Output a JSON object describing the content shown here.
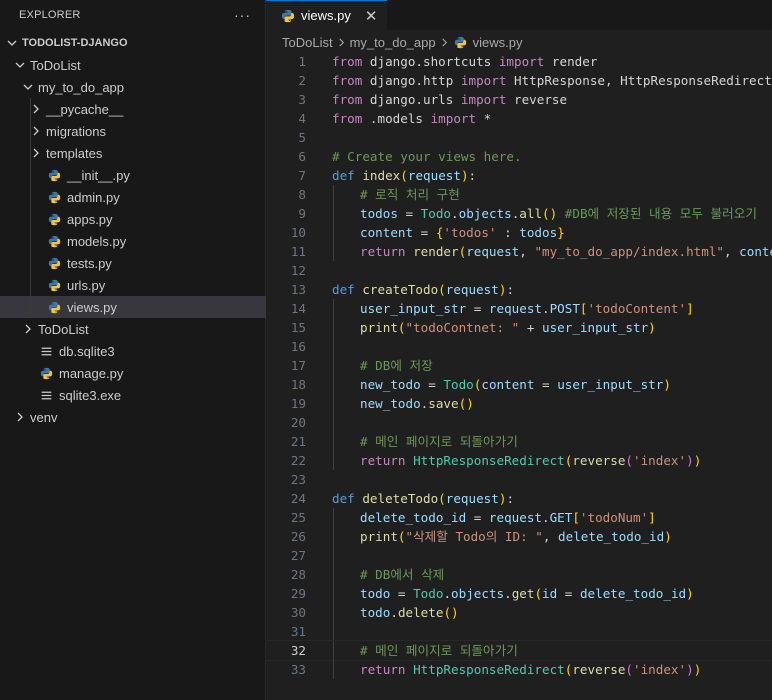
{
  "sidebar": {
    "title": "EXPLORER",
    "more_label": "···",
    "items": [
      {
        "label": "TODOLIST-DJANGO",
        "kind": "root-folder",
        "expanded": true,
        "level": 0
      },
      {
        "label": "ToDoList",
        "kind": "folder",
        "expanded": true,
        "level": 1
      },
      {
        "label": "my_to_do_app",
        "kind": "folder",
        "expanded": true,
        "level": 2
      },
      {
        "label": "__pycache__",
        "kind": "folder",
        "expanded": false,
        "level": 3
      },
      {
        "label": "migrations",
        "kind": "folder",
        "expanded": false,
        "level": 3
      },
      {
        "label": "templates",
        "kind": "folder",
        "expanded": false,
        "level": 3
      },
      {
        "label": "__init__.py",
        "kind": "python-file",
        "level": 3
      },
      {
        "label": "admin.py",
        "kind": "python-file",
        "level": 3
      },
      {
        "label": "apps.py",
        "kind": "python-file",
        "level": 3
      },
      {
        "label": "models.py",
        "kind": "python-file",
        "level": 3
      },
      {
        "label": "tests.py",
        "kind": "python-file",
        "level": 3
      },
      {
        "label": "urls.py",
        "kind": "python-file",
        "level": 3
      },
      {
        "label": "views.py",
        "kind": "python-file",
        "level": 3,
        "selected": true
      },
      {
        "label": "ToDoList",
        "kind": "folder",
        "expanded": false,
        "level": 2
      },
      {
        "label": "db.sqlite3",
        "kind": "db-file",
        "level": 2
      },
      {
        "label": "manage.py",
        "kind": "python-file",
        "level": 2
      },
      {
        "label": "sqlite3.exe",
        "kind": "db-file",
        "level": 2
      },
      {
        "label": "venv",
        "kind": "folder",
        "expanded": false,
        "level": 1
      }
    ]
  },
  "tab": {
    "label": "views.py",
    "close_label": "✕",
    "icon": "python-file-icon"
  },
  "breadcrumb": [
    "ToDoList",
    "my_to_do_app",
    "views.py"
  ],
  "editor": {
    "current_line": 32,
    "lines": [
      {
        "n": "1",
        "tokens": [
          [
            "kw",
            "from"
          ],
          [
            "plain",
            " django.shortcuts "
          ],
          [
            "kw",
            "import"
          ],
          [
            "plain",
            " render"
          ]
        ]
      },
      {
        "n": "2",
        "tokens": [
          [
            "kw",
            "from"
          ],
          [
            "plain",
            " django.http "
          ],
          [
            "kw",
            "import"
          ],
          [
            "plain",
            " HttpResponse, HttpResponseRedirect"
          ]
        ]
      },
      {
        "n": "3",
        "tokens": [
          [
            "kw",
            "from"
          ],
          [
            "plain",
            " django.urls "
          ],
          [
            "kw",
            "import"
          ],
          [
            "plain",
            " reverse"
          ]
        ]
      },
      {
        "n": "4",
        "tokens": [
          [
            "kw",
            "from"
          ],
          [
            "plain",
            " .models "
          ],
          [
            "kw",
            "import"
          ],
          [
            "plain",
            " *"
          ]
        ]
      },
      {
        "n": "5",
        "tokens": []
      },
      {
        "n": "6",
        "tokens": [
          [
            "cm",
            "# Create your views here."
          ]
        ]
      },
      {
        "n": "7",
        "tokens": [
          [
            "kw2",
            "def"
          ],
          [
            "plain",
            " "
          ],
          [
            "fn",
            "index"
          ],
          [
            "brk1",
            "("
          ],
          [
            "var",
            "request"
          ],
          [
            "brk1",
            ")"
          ],
          [
            "plain",
            ":"
          ]
        ]
      },
      {
        "n": "8",
        "indent": 1,
        "tokens": [
          [
            "cm",
            "# 로직 처리 구현"
          ]
        ]
      },
      {
        "n": "9",
        "indent": 1,
        "tokens": [
          [
            "var",
            "todos"
          ],
          [
            "plain",
            " = "
          ],
          [
            "cls",
            "Todo"
          ],
          [
            "plain",
            "."
          ],
          [
            "var",
            "objects"
          ],
          [
            "plain",
            "."
          ],
          [
            "fn",
            "all"
          ],
          [
            "brk1",
            "()"
          ],
          [
            "plain",
            " "
          ],
          [
            "cm",
            "#DB에 저장된 내용 모두 불러오기"
          ]
        ]
      },
      {
        "n": "10",
        "indent": 1,
        "tokens": [
          [
            "var",
            "content"
          ],
          [
            "plain",
            " = "
          ],
          [
            "brk1",
            "{"
          ],
          [
            "str",
            "'todos'"
          ],
          [
            "plain",
            " : "
          ],
          [
            "var",
            "todos"
          ],
          [
            "brk1",
            "}"
          ]
        ]
      },
      {
        "n": "11",
        "indent": 1,
        "tokens": [
          [
            "kw",
            "return"
          ],
          [
            "plain",
            " "
          ],
          [
            "fn",
            "render"
          ],
          [
            "brk1",
            "("
          ],
          [
            "var",
            "request"
          ],
          [
            "plain",
            ", "
          ],
          [
            "str",
            "\"my_to_do_app/index.html\""
          ],
          [
            "plain",
            ", "
          ],
          [
            "var",
            "content"
          ],
          [
            "brk1",
            ")"
          ]
        ]
      },
      {
        "n": "12",
        "tokens": []
      },
      {
        "n": "13",
        "tokens": [
          [
            "kw2",
            "def"
          ],
          [
            "plain",
            " "
          ],
          [
            "fn",
            "createTodo"
          ],
          [
            "brk1",
            "("
          ],
          [
            "var",
            "request"
          ],
          [
            "brk1",
            ")"
          ],
          [
            "plain",
            ":"
          ]
        ]
      },
      {
        "n": "14",
        "indent": 1,
        "tokens": [
          [
            "var",
            "user_input_str"
          ],
          [
            "plain",
            " = "
          ],
          [
            "var",
            "request"
          ],
          [
            "plain",
            "."
          ],
          [
            "var",
            "POST"
          ],
          [
            "brk1",
            "["
          ],
          [
            "str",
            "'todoContent'"
          ],
          [
            "brk1",
            "]"
          ]
        ]
      },
      {
        "n": "15",
        "indent": 1,
        "tokens": [
          [
            "fn",
            "print"
          ],
          [
            "brk1",
            "("
          ],
          [
            "str",
            "\"todoContnet: \""
          ],
          [
            "plain",
            " + "
          ],
          [
            "var",
            "user_input_str"
          ],
          [
            "brk1",
            ")"
          ]
        ]
      },
      {
        "n": "16",
        "indent": 1,
        "tokens": []
      },
      {
        "n": "17",
        "indent": 1,
        "tokens": [
          [
            "cm",
            "# DB에 저장"
          ]
        ]
      },
      {
        "n": "18",
        "indent": 1,
        "tokens": [
          [
            "var",
            "new_todo"
          ],
          [
            "plain",
            " = "
          ],
          [
            "cls",
            "Todo"
          ],
          [
            "brk1",
            "("
          ],
          [
            "var",
            "content"
          ],
          [
            "plain",
            " = "
          ],
          [
            "var",
            "user_input_str"
          ],
          [
            "brk1",
            ")"
          ]
        ]
      },
      {
        "n": "19",
        "indent": 1,
        "tokens": [
          [
            "var",
            "new_todo"
          ],
          [
            "plain",
            "."
          ],
          [
            "fn",
            "save"
          ],
          [
            "brk1",
            "()"
          ]
        ]
      },
      {
        "n": "20",
        "indent": 1,
        "tokens": []
      },
      {
        "n": "21",
        "indent": 1,
        "tokens": [
          [
            "cm",
            "# 메인 페이지로 되돌아가기"
          ]
        ]
      },
      {
        "n": "22",
        "indent": 1,
        "tokens": [
          [
            "kw",
            "return"
          ],
          [
            "plain",
            " "
          ],
          [
            "cls",
            "HttpResponseRedirect"
          ],
          [
            "brk1",
            "("
          ],
          [
            "fn",
            "reverse"
          ],
          [
            "brk2",
            "("
          ],
          [
            "str",
            "'index'"
          ],
          [
            "brk2",
            ")"
          ],
          [
            "brk1",
            ")"
          ]
        ]
      },
      {
        "n": "23",
        "tokens": []
      },
      {
        "n": "24",
        "tokens": [
          [
            "kw2",
            "def"
          ],
          [
            "plain",
            " "
          ],
          [
            "fn",
            "deleteTodo"
          ],
          [
            "brk1",
            "("
          ],
          [
            "var",
            "request"
          ],
          [
            "brk1",
            ")"
          ],
          [
            "plain",
            ":"
          ]
        ]
      },
      {
        "n": "25",
        "indent": 1,
        "tokens": [
          [
            "var",
            "delete_todo_id"
          ],
          [
            "plain",
            " = "
          ],
          [
            "var",
            "request"
          ],
          [
            "plain",
            "."
          ],
          [
            "var",
            "GET"
          ],
          [
            "brk1",
            "["
          ],
          [
            "str",
            "'todoNum'"
          ],
          [
            "brk1",
            "]"
          ]
        ]
      },
      {
        "n": "26",
        "indent": 1,
        "tokens": [
          [
            "fn",
            "print"
          ],
          [
            "brk1",
            "("
          ],
          [
            "str",
            "\"삭제할 Todo의 ID: \""
          ],
          [
            "plain",
            ", "
          ],
          [
            "var",
            "delete_todo_id"
          ],
          [
            "brk1",
            ")"
          ]
        ]
      },
      {
        "n": "27",
        "indent": 1,
        "tokens": []
      },
      {
        "n": "28",
        "indent": 1,
        "tokens": [
          [
            "cm",
            "# DB에서 삭제"
          ]
        ]
      },
      {
        "n": "29",
        "indent": 1,
        "tokens": [
          [
            "var",
            "todo"
          ],
          [
            "plain",
            " = "
          ],
          [
            "cls",
            "Todo"
          ],
          [
            "plain",
            "."
          ],
          [
            "var",
            "objects"
          ],
          [
            "plain",
            "."
          ],
          [
            "fn",
            "get"
          ],
          [
            "brk1",
            "("
          ],
          [
            "var",
            "id"
          ],
          [
            "plain",
            " = "
          ],
          [
            "var",
            "delete_todo_id"
          ],
          [
            "brk1",
            ")"
          ]
        ]
      },
      {
        "n": "30",
        "indent": 1,
        "tokens": [
          [
            "var",
            "todo"
          ],
          [
            "plain",
            "."
          ],
          [
            "fn",
            "delete"
          ],
          [
            "brk1",
            "()"
          ]
        ]
      },
      {
        "n": "31",
        "indent": 1,
        "tokens": []
      },
      {
        "n": "32",
        "indent": 1,
        "tokens": [
          [
            "cm",
            "# 메인 페이지로 되돌아가기"
          ]
        ]
      },
      {
        "n": "33",
        "indent": 1,
        "tokens": [
          [
            "kw",
            "return"
          ],
          [
            "plain",
            " "
          ],
          [
            "cls",
            "HttpResponseRedirect"
          ],
          [
            "brk1",
            "("
          ],
          [
            "fn",
            "reverse"
          ],
          [
            "brk2",
            "("
          ],
          [
            "str",
            "'index'"
          ],
          [
            "brk2",
            ")"
          ],
          [
            "brk1",
            ")"
          ]
        ]
      }
    ]
  },
  "colors": {
    "background": "#1f1f1f",
    "sidebar": "#181818",
    "selection": "#37373d",
    "accent": "#0078d4",
    "python_blue": "#3572a5",
    "python_yellow": "#ffd43b"
  }
}
